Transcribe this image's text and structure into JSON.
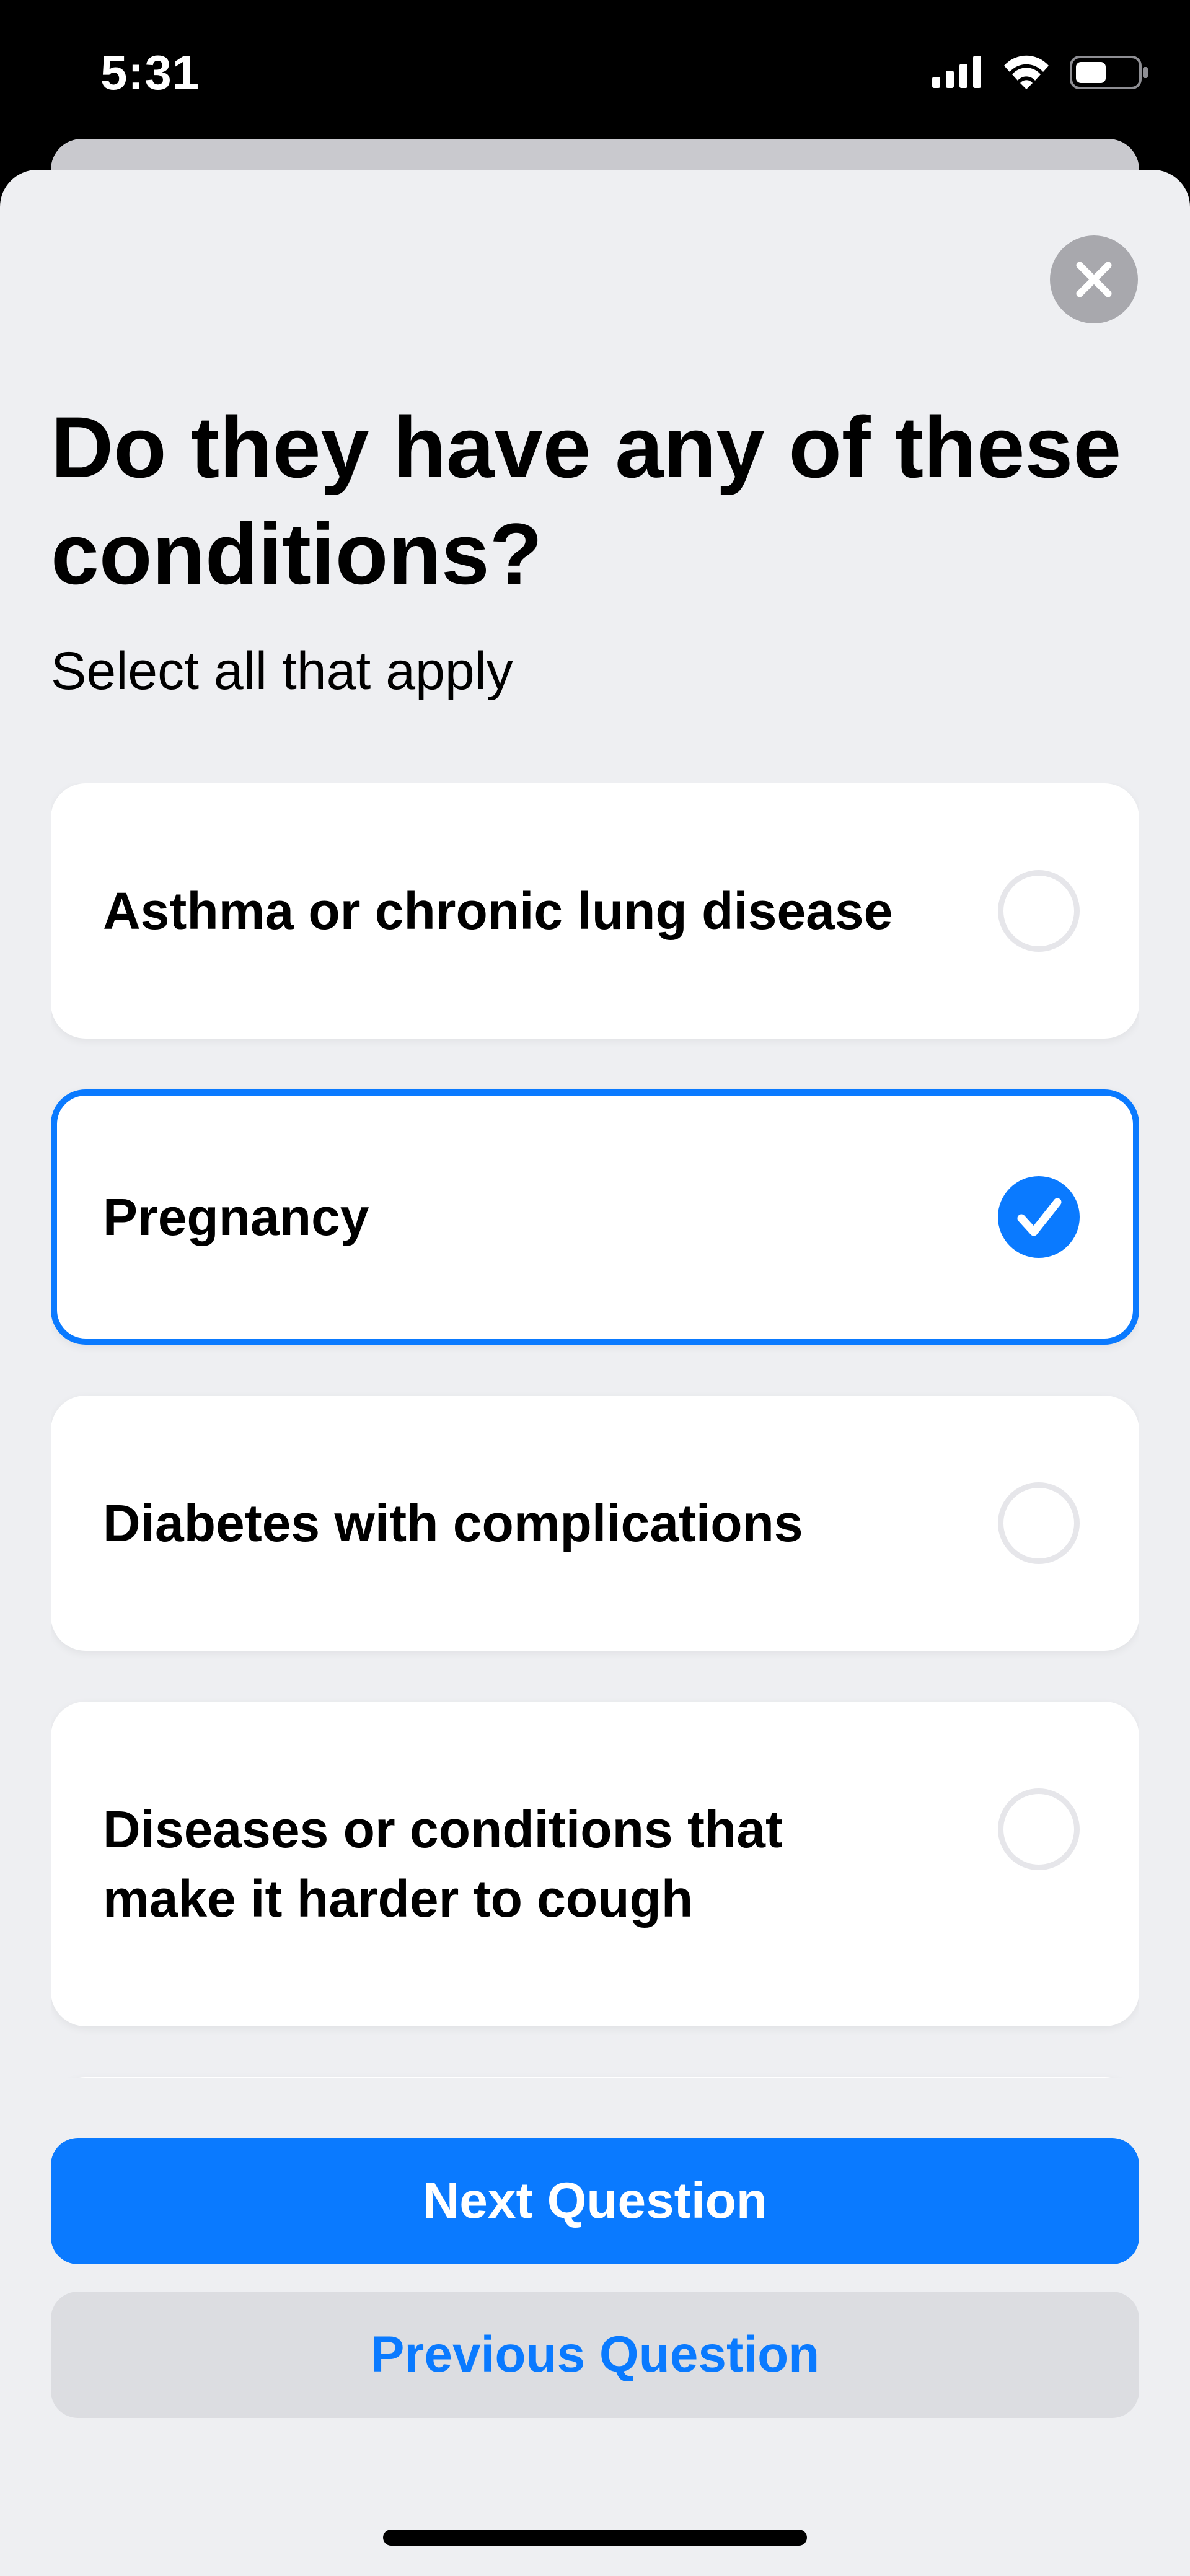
{
  "status_bar": {
    "time": "5:31",
    "icons": [
      "cellular-signal-icon",
      "wifi-icon",
      "battery-icon"
    ]
  },
  "question": {
    "title": "Do they have any of these conditions?",
    "subtitle": "Select all that apply"
  },
  "options": [
    {
      "label": "Asthma or chronic lung disease",
      "selected": false
    },
    {
      "label": "Pregnancy",
      "selected": true
    },
    {
      "label": "Diabetes with complications",
      "selected": false
    },
    {
      "label": "Diseases or conditions that make it harder to cough",
      "selected": false
    },
    {
      "label": "",
      "selected": false
    }
  ],
  "buttons": {
    "next": "Next Question",
    "previous": "Previous Question"
  },
  "icons": {
    "close": "close-icon",
    "check": "checkmark-icon"
  },
  "colors": {
    "accent": "#0a7aff",
    "sheet_background": "#eeeff2",
    "card_background": "#ffffff",
    "secondary_button": "#dcdde1",
    "close_button": "#a8a8ad"
  }
}
